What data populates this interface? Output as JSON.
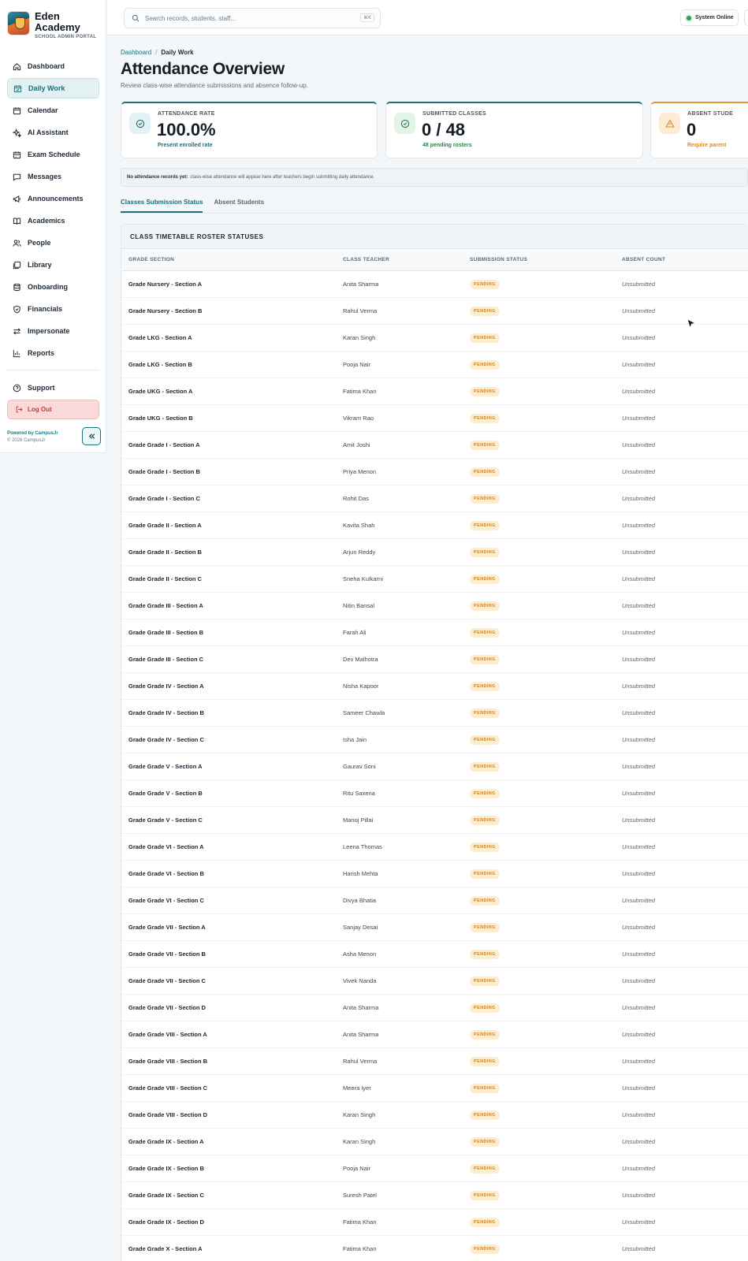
{
  "brand": {
    "name": "Eden Academy",
    "subtitle": "SCHOOL ADMIN PORTAL"
  },
  "sidebar": {
    "items": [
      {
        "label": "Dashboard",
        "icon": "home-icon"
      },
      {
        "label": "Daily Work",
        "icon": "calendar-check-icon",
        "active": true
      },
      {
        "label": "Calendar",
        "icon": "calendar-icon"
      },
      {
        "label": "AI Assistant",
        "icon": "sparkles-icon"
      },
      {
        "label": "Exam Schedule",
        "icon": "calendar-clock-icon"
      },
      {
        "label": "Messages",
        "icon": "message-icon"
      },
      {
        "label": "Announcements",
        "icon": "megaphone-icon"
      },
      {
        "label": "Academics",
        "icon": "book-icon"
      },
      {
        "label": "People",
        "icon": "users-icon"
      },
      {
        "label": "Library",
        "icon": "library-icon"
      },
      {
        "label": "Onboarding",
        "icon": "database-icon"
      },
      {
        "label": "Financials",
        "icon": "shield-icon"
      },
      {
        "label": "Impersonate",
        "icon": "arrows-icon"
      },
      {
        "label": "Reports",
        "icon": "bar-chart-icon"
      }
    ],
    "support_label": "Support",
    "logout_label": "Log Out",
    "powered_by": "Powered by CampusJr",
    "copyright": "© 2026 CampusJr"
  },
  "topbar": {
    "search_placeholder": "Search records, students, staff...",
    "shortcut": "⌘K",
    "status_label": "System Online"
  },
  "page": {
    "breadcrumb": [
      "Dashboard",
      "Daily Work"
    ],
    "title": "Attendance Overview",
    "subtitle": "Review class-wise attendance submissions and absence follow-up."
  },
  "stats": [
    {
      "label": "ATTENDANCE RATE",
      "value": "100.0%",
      "note": "Present enrolled rate",
      "icon": "check-circle-icon"
    },
    {
      "label": "SUBMITTED CLASSES",
      "value": "0 / 48",
      "note": "48 pending rosters",
      "icon": "check-circle-icon"
    },
    {
      "label": "ABSENT STUDE",
      "value": "0",
      "note": "Require parent",
      "icon": "warning-icon"
    }
  ],
  "notice": {
    "bold": "No attendance records yet:",
    "text": "class-wise attendance will appear here after teachers begin submitting daily attendance."
  },
  "tabs": [
    "Classes Submission Status",
    "Absent Students"
  ],
  "table": {
    "title": "CLASS TIMETABLE ROSTER STATUSES",
    "columns": [
      "GRADE SECTION",
      "CLASS TEACHER",
      "SUBMISSION STATUS",
      "ABSENT COUNT"
    ],
    "rows": [
      [
        "Grade Nursery - Section A",
        "Anita Sharma",
        "PENDING",
        "Unsubmitted"
      ],
      [
        "Grade Nursery - Section B",
        "Rahul Verma",
        "PENDING",
        "Unsubmitted"
      ],
      [
        "Grade LKG - Section A",
        "Karan Singh",
        "PENDING",
        "Unsubmitted"
      ],
      [
        "Grade LKG - Section B",
        "Pooja Nair",
        "PENDING",
        "Unsubmitted"
      ],
      [
        "Grade UKG - Section A",
        "Fatima Khan",
        "PENDING",
        "Unsubmitted"
      ],
      [
        "Grade UKG - Section B",
        "Vikram Rao",
        "PENDING",
        "Unsubmitted"
      ],
      [
        "Grade Grade I - Section A",
        "Amit Joshi",
        "PENDING",
        "Unsubmitted"
      ],
      [
        "Grade Grade I - Section B",
        "Priya Menon",
        "PENDING",
        "Unsubmitted"
      ],
      [
        "Grade Grade I - Section C",
        "Rohit Das",
        "PENDING",
        "Unsubmitted"
      ],
      [
        "Grade Grade II - Section A",
        "Kavita Shah",
        "PENDING",
        "Unsubmitted"
      ],
      [
        "Grade Grade II - Section B",
        "Arjun Reddy",
        "PENDING",
        "Unsubmitted"
      ],
      [
        "Grade Grade II - Section C",
        "Sneha Kulkarni",
        "PENDING",
        "Unsubmitted"
      ],
      [
        "Grade Grade III - Section A",
        "Nitin Bansal",
        "PENDING",
        "Unsubmitted"
      ],
      [
        "Grade Grade III - Section B",
        "Farah Ali",
        "PENDING",
        "Unsubmitted"
      ],
      [
        "Grade Grade III - Section C",
        "Dev Malhotra",
        "PENDING",
        "Unsubmitted"
      ],
      [
        "Grade Grade IV - Section A",
        "Nisha Kapoor",
        "PENDING",
        "Unsubmitted"
      ],
      [
        "Grade Grade IV - Section B",
        "Sameer Chawla",
        "PENDING",
        "Unsubmitted"
      ],
      [
        "Grade Grade IV - Section C",
        "Isha Jain",
        "PENDING",
        "Unsubmitted"
      ],
      [
        "Grade Grade V - Section A",
        "Gaurav Soni",
        "PENDING",
        "Unsubmitted"
      ],
      [
        "Grade Grade V - Section B",
        "Ritu Saxena",
        "PENDING",
        "Unsubmitted"
      ],
      [
        "Grade Grade V - Section C",
        "Manoj Pillai",
        "PENDING",
        "Unsubmitted"
      ],
      [
        "Grade Grade VI - Section A",
        "Leena Thomas",
        "PENDING",
        "Unsubmitted"
      ],
      [
        "Grade Grade VI - Section B",
        "Harish Mehta",
        "PENDING",
        "Unsubmitted"
      ],
      [
        "Grade Grade VI - Section C",
        "Divya Bhatia",
        "PENDING",
        "Unsubmitted"
      ],
      [
        "Grade Grade VII - Section A",
        "Sanjay Desai",
        "PENDING",
        "Unsubmitted"
      ],
      [
        "Grade Grade VII - Section B",
        "Asha Menon",
        "PENDING",
        "Unsubmitted"
      ],
      [
        "Grade Grade VII - Section C",
        "Vivek Nanda",
        "PENDING",
        "Unsubmitted"
      ],
      [
        "Grade Grade VII - Section D",
        "Anita Sharma",
        "PENDING",
        "Unsubmitted"
      ],
      [
        "Grade Grade VIII - Section A",
        "Anita Sharma",
        "PENDING",
        "Unsubmitted"
      ],
      [
        "Grade Grade VIII - Section B",
        "Rahul Verma",
        "PENDING",
        "Unsubmitted"
      ],
      [
        "Grade Grade VIII - Section C",
        "Meera Iyer",
        "PENDING",
        "Unsubmitted"
      ],
      [
        "Grade Grade VIII - Section D",
        "Karan Singh",
        "PENDING",
        "Unsubmitted"
      ],
      [
        "Grade Grade IX - Section A",
        "Karan Singh",
        "PENDING",
        "Unsubmitted"
      ],
      [
        "Grade Grade IX - Section B",
        "Pooja Nair",
        "PENDING",
        "Unsubmitted"
      ],
      [
        "Grade Grade IX - Section C",
        "Suresh Patel",
        "PENDING",
        "Unsubmitted"
      ],
      [
        "Grade Grade IX - Section D",
        "Fatima Khan",
        "PENDING",
        "Unsubmitted"
      ],
      [
        "Grade Grade X - Section A",
        "Fatima Khan",
        "PENDING",
        "Unsubmitted"
      ]
    ]
  },
  "colors": {
    "accent": "#1a6f7d",
    "pending_badge": "#fdeccd",
    "pending_text": "#c9862a",
    "logout_bg": "#fbd9d9",
    "status_online": "#2a9d5c"
  }
}
